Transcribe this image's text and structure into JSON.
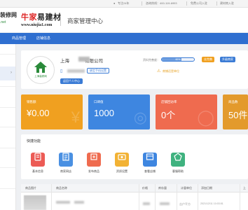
{
  "topbar": {
    "items": [
      "专注24年",
      "咨询热线：400-119-6993",
      "免费公司入驻",
      "建材商入驻"
    ]
  },
  "header": {
    "left_fragment": "装修网",
    "left_domain": ".net",
    "brand_red": "牛家",
    "brand_dark": "易建材",
    "brand_url": "www.niujia1.com",
    "center_title": "商家管理中心"
  },
  "nav": {
    "items": [
      "商品管理",
      "店铺信息"
    ]
  },
  "profile": {
    "company_prefix": "上海",
    "company_suffix": "有限公司",
    "avatar_brand": "上海装修网",
    "bind_phone_label": "绑定手机设置",
    "return_label": "返回个人中心",
    "completeness_label": "资料完善度：",
    "completeness_percent": 0.6,
    "completeness_text": "60%",
    "improve_label": "去完善",
    "upgrade_label": "升级商家",
    "unset_label": "商铺还是单位"
  },
  "stats": [
    {
      "label": "销售额",
      "value": "¥0.00",
      "color": "#f0a020",
      "watermark": "¥"
    },
    {
      "label": "口碑值",
      "value": "1000",
      "color": "#3e86e0",
      "watermark": "◎"
    },
    {
      "label": "店铺回访率",
      "value": "0个",
      "color": "#ef6b4f",
      "watermark": "◯"
    },
    {
      "label": "商品数",
      "value": "50件",
      "color": "#e39a2c",
      "watermark": "▣"
    }
  ],
  "quick": {
    "title": "快捷功能",
    "items": [
      {
        "label": "基本信息",
        "color": "#ec5b55",
        "icon": "info-icon"
      },
      {
        "label": "商家网店",
        "color": "#4a90e2",
        "icon": "shop-icon"
      },
      {
        "label": "发布商品",
        "color": "#ef6b4f",
        "icon": "publish-icon"
      },
      {
        "label": "资质设置",
        "color": "#f2b234",
        "icon": "certificate-icon"
      },
      {
        "label": "查看店铺",
        "color": "#3e86e0",
        "icon": "store-icon"
      },
      {
        "label": "客服帮助",
        "color": "#3fb27f",
        "icon": "help-icon"
      }
    ]
  },
  "table": {
    "headers": [
      "商品图片",
      "商品名称",
      "价格",
      "库存量",
      "计量单位",
      "添加日期",
      "上"
    ],
    "row": {
      "unit": "吉户平方",
      "date": "2021/12/11 10:03:51"
    }
  }
}
